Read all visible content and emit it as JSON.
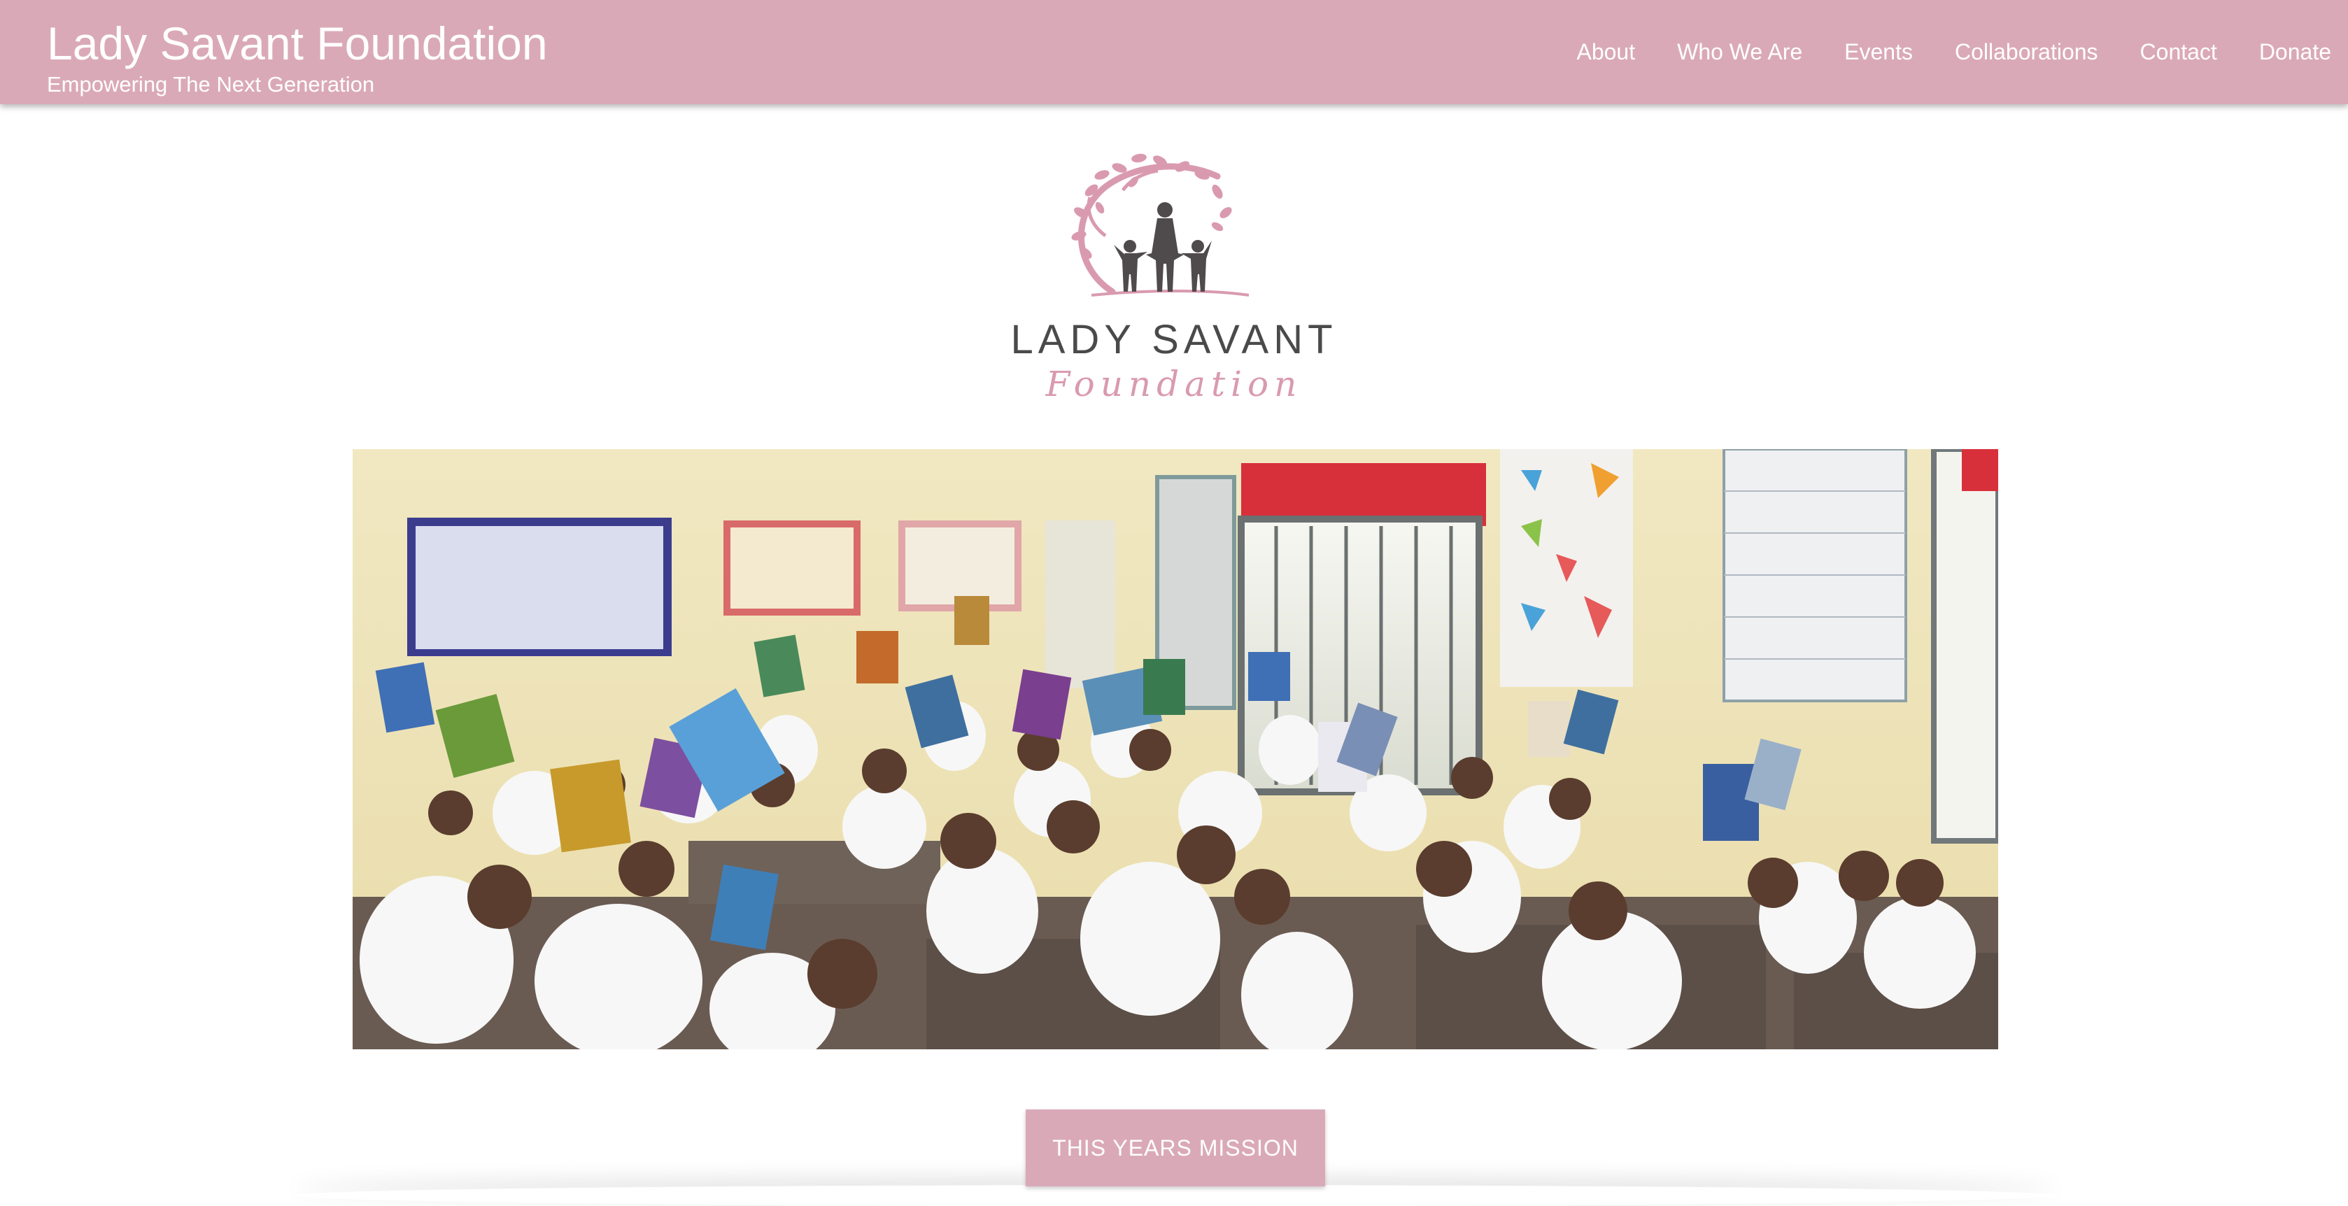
{
  "header": {
    "title": "Lady Savant Foundation",
    "tagline": "Empowering The Next Generation",
    "nav": [
      "About",
      "Who We Are",
      "Events",
      "Collaborations",
      "Contact",
      "Donate"
    ]
  },
  "logo": {
    "wordmark": "LADY SAVANT",
    "script": "Foundation"
  },
  "hero": {
    "icon": "classroom-photo"
  },
  "cta": {
    "label": "THIS YEARS MISSION"
  },
  "colors": {
    "brand_pink": "#daa9b8",
    "logo_gray": "#4a4a4a",
    "logo_pink": "#d99ab0"
  }
}
